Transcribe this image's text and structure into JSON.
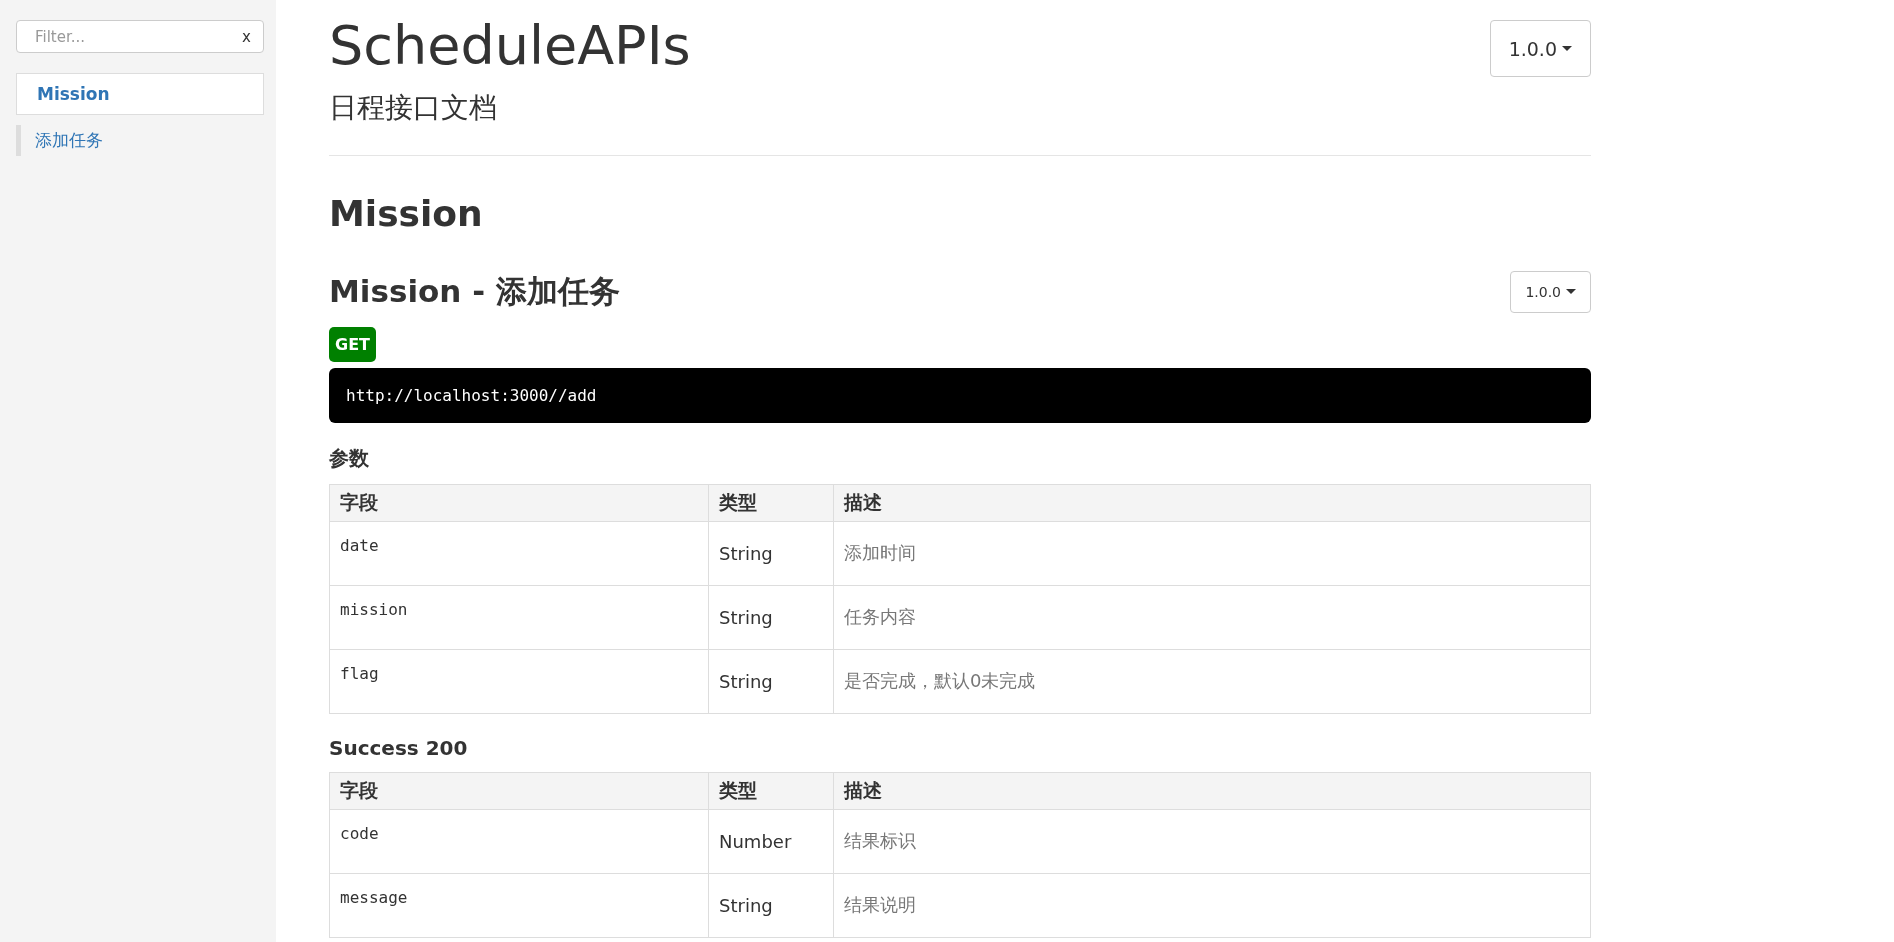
{
  "sidebar": {
    "filter": {
      "placeholder": "Filter...",
      "clear": "x"
    },
    "groups": [
      {
        "title": "Mission",
        "items": [
          {
            "label": "添加任务"
          }
        ]
      }
    ]
  },
  "header": {
    "title": "ScheduleAPIs",
    "subtitle": "日程接口文档",
    "version": "1.0.0"
  },
  "section": {
    "title": "Mission",
    "endpoint": {
      "title": "Mission - 添加任务",
      "version": "1.0.0",
      "method": "GET",
      "url": "http://localhost:3000//add",
      "tables": [
        {
          "title": "参数",
          "columns": [
            "字段",
            "类型",
            "描述"
          ],
          "rows": [
            {
              "field": "date",
              "type": "String",
              "description": "添加时间"
            },
            {
              "field": "mission",
              "type": "String",
              "description": "任务内容"
            },
            {
              "field": "flag",
              "type": "String",
              "description": "是否完成，默认0未完成"
            }
          ]
        },
        {
          "title": "Success 200",
          "columns": [
            "字段",
            "类型",
            "描述"
          ],
          "rows": [
            {
              "field": "code",
              "type": "Number",
              "description": "结果标识"
            },
            {
              "field": "message",
              "type": "String",
              "description": "结果说明"
            }
          ]
        }
      ]
    }
  }
}
